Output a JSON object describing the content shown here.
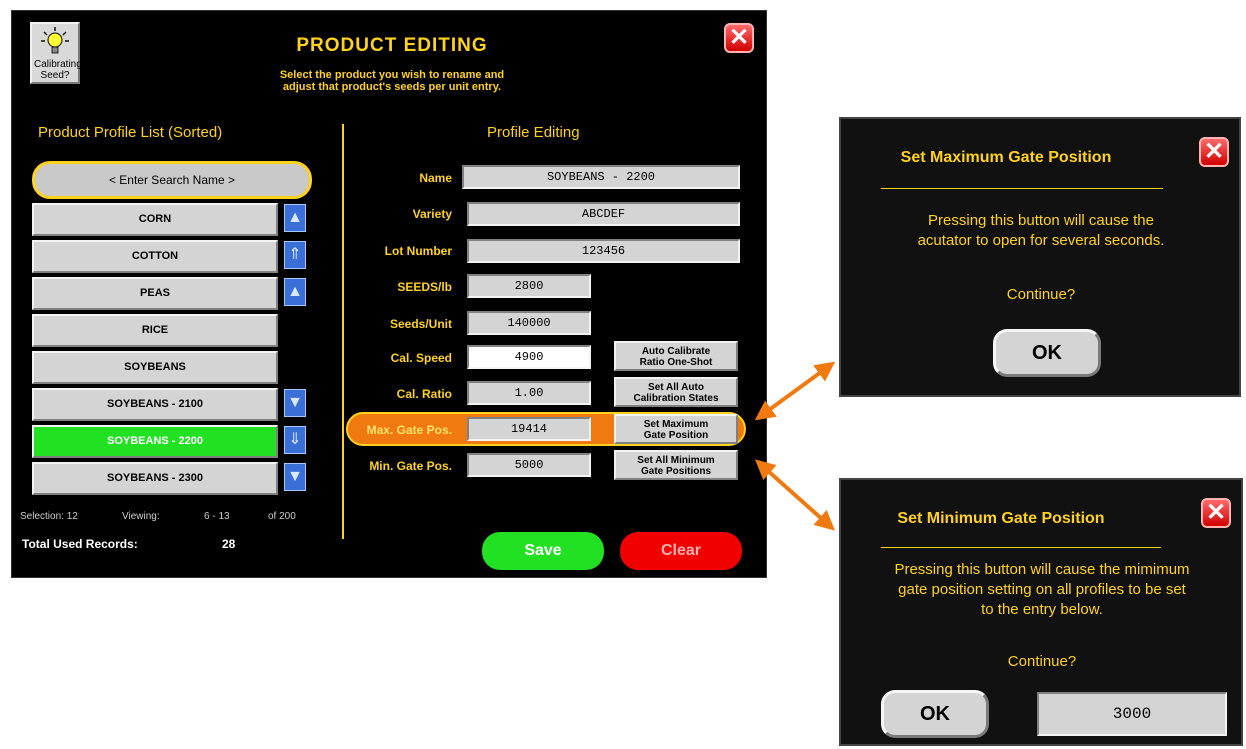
{
  "header": {
    "help_button_label": "Calibrating Seed?",
    "title": "PRODUCT EDITING",
    "subtitle_line1": "Select the product you wish to rename and",
    "subtitle_line2": "adjust that product's seeds per unit entry."
  },
  "list_panel": {
    "heading": "Product Profile List (Sorted)",
    "search_placeholder": "< Enter Search Name >",
    "items": [
      {
        "label": "CORN",
        "selected": false
      },
      {
        "label": "COTTON",
        "selected": false
      },
      {
        "label": "PEAS",
        "selected": false
      },
      {
        "label": "RICE",
        "selected": false
      },
      {
        "label": "SOYBEANS",
        "selected": false
      },
      {
        "label": "SOYBEANS - 2100",
        "selected": false
      },
      {
        "label": "SOYBEANS - 2200",
        "selected": true
      },
      {
        "label": "SOYBEANS - 2300",
        "selected": false
      }
    ],
    "selection_label": "Selection: 12",
    "viewing_label": "Viewing:",
    "viewing_range": "6 - 13",
    "viewing_total": "of 200",
    "records_label": "Total Used Records:",
    "records_value": "28"
  },
  "profile_panel": {
    "heading": "Profile Editing",
    "fields": {
      "name": {
        "label": "Name",
        "value": "SOYBEANS - 2200"
      },
      "variety": {
        "label": "Variety",
        "value": "ABCDEF"
      },
      "lot": {
        "label": "Lot Number",
        "value": "123456"
      },
      "seeds_lb": {
        "label": "SEEDS/lb",
        "value": "2800"
      },
      "seeds_unit": {
        "label": "Seeds/Unit",
        "value": "140000"
      },
      "cal_speed": {
        "label": "Cal. Speed",
        "value": "4900"
      },
      "cal_ratio": {
        "label": "Cal. Ratio",
        "value": "1.00"
      },
      "max_gate": {
        "label": "Max. Gate Pos.",
        "value": "19414"
      },
      "min_gate": {
        "label": "Min. Gate Pos.",
        "value": "5000"
      }
    },
    "buttons": {
      "auto_cal_1": "Auto Calibrate",
      "auto_cal_2": "Ratio One-Shot",
      "set_all_auto_1": "Set All Auto",
      "set_all_auto_2": "Calibration States",
      "set_max_1": "Set Maximum",
      "set_max_2": "Gate Position",
      "set_min_1": "Set All Minimum",
      "set_min_2": "Gate Positions",
      "save": "Save",
      "clear": "Clear"
    }
  },
  "dialog_max": {
    "title": "Set Maximum Gate Position",
    "body_line1": "Pressing this button will cause the",
    "body_line2": "acutator to open for several seconds.",
    "continue": "Continue?",
    "ok": "OK"
  },
  "dialog_min": {
    "title": "Set Minimum Gate Position",
    "body_line1": "Pressing this button will cause the mimimum",
    "body_line2": "gate position setting on all profiles to be set",
    "body_line3": "to the entry below.",
    "continue": "Continue?",
    "ok": "OK",
    "entry_value": "3000"
  },
  "colors": {
    "accent_yellow": "#ffd21e",
    "selected_green": "#22e022",
    "highlight_orange": "#f07a10",
    "callout_arrow": "#f07a10"
  }
}
